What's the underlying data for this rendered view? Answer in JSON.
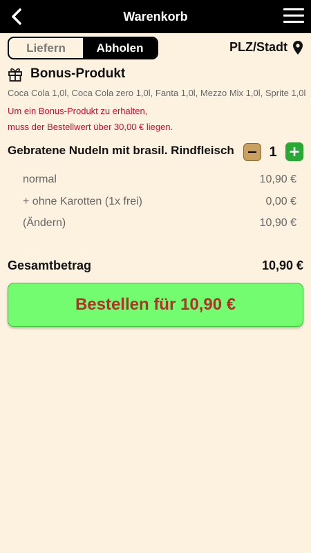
{
  "header": {
    "title": "Warenkorb",
    "back_icon": "chevron-left-icon",
    "menu_icon": "hamburger-menu-icon"
  },
  "mode_toggle": {
    "options": [
      "Liefern",
      "Abholen"
    ],
    "selected": "Abholen"
  },
  "location": {
    "label": "PLZ/Stadt",
    "icon": "map-pin-icon"
  },
  "bonus": {
    "icon": "gift-icon",
    "title": "Bonus-Produkt",
    "products": "Coca Cola 1,0l, Coca Cola zero 1,0l, Fanta 1,0l, Mezzo Mix 1,0l, Sprite 1,0l",
    "note_line1": "Um ein Bonus-Produkt zu erhalten,",
    "note_line2": "muss der Bestellwert über 30,00 € liegen."
  },
  "cart": {
    "item": {
      "name": "Gebratene Nudeln mit brasil. Rindfleisch",
      "quantity": "1",
      "lines": [
        {
          "label": "normal",
          "price": "10,90 €"
        },
        {
          "label": "+ ohne Karotten (1x frei)",
          "price": "0,00 €"
        },
        {
          "label": "(Ändern)",
          "price": "10,90 €"
        }
      ]
    },
    "total_label": "Gesamtbetrag",
    "total_value": "10,90 €",
    "order_button": "Bestellen für 10,90 €"
  },
  "colors": {
    "background": "#fdf2e0",
    "header": "#000000",
    "warning_red": "#c8102e",
    "order_button_bg": "#74fc70",
    "order_button_text": "#b5302a",
    "plus_green": "#2aa836",
    "minus_tan": "#c8a060"
  }
}
